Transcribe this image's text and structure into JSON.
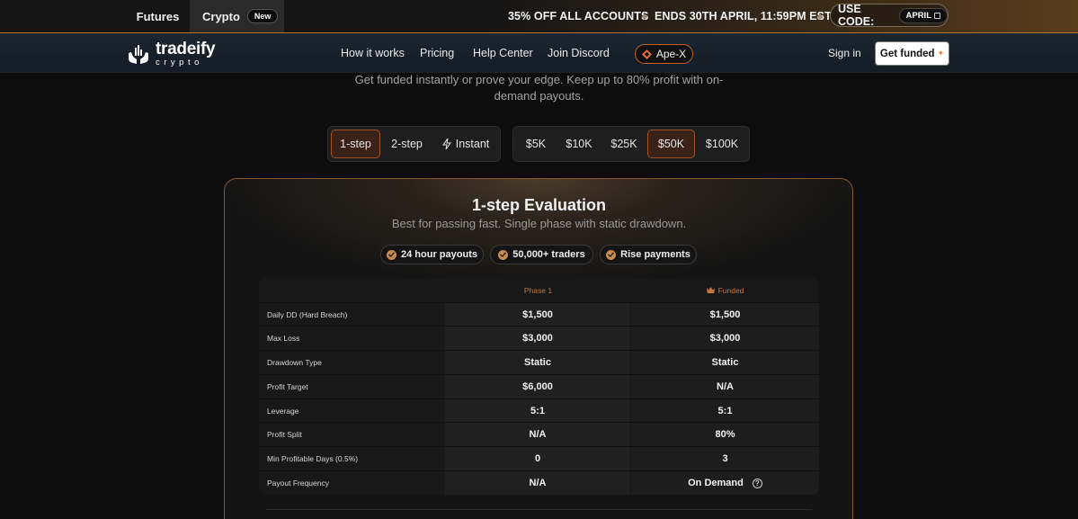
{
  "promo": {
    "tabs": [
      {
        "label": "Futures"
      },
      {
        "label": "Crypto",
        "badge": "New"
      }
    ],
    "messages": [
      "35% OFF ALL ACCOUNTS",
      "ENDS 30TH APRIL, 11:59PM EST"
    ],
    "code_label": "USE CODE:",
    "code_value": "APRIL"
  },
  "nav": {
    "brand_name": "tradeify",
    "brand_sub": "crypto",
    "links": [
      "How it works",
      "Pricing",
      "Help Center",
      "Join Discord"
    ],
    "apex_label": "Ape-X",
    "sign_in": "Sign in",
    "cta": "Get funded"
  },
  "hero": {
    "subtitle": "Get funded instantly or prove your edge. Keep up to 80% profit with on-demand payouts."
  },
  "selectors": {
    "steps": [
      {
        "label": "1-step",
        "active": true
      },
      {
        "label": "2-step",
        "active": false
      },
      {
        "label": "Instant",
        "active": false
      }
    ],
    "sizes": [
      {
        "label": "$5K",
        "active": false
      },
      {
        "label": "$10K",
        "active": false
      },
      {
        "label": "$25K",
        "active": false
      },
      {
        "label": "$50K",
        "active": true
      },
      {
        "label": "$100K",
        "active": false
      }
    ]
  },
  "card": {
    "title": "1-step Evaluation",
    "subtitle": "Best for passing fast. Single phase with static drawdown.",
    "badges": [
      "24 hour payouts",
      "50,000+ traders",
      "Rise payments"
    ]
  },
  "table": {
    "columns": [
      "Phase 1",
      "Funded"
    ],
    "rows": [
      {
        "label": "Daily DD (Hard Breach)",
        "phase1": "$1,500",
        "funded": "$1,500"
      },
      {
        "label": "Max Loss",
        "phase1": "$3,000",
        "funded": "$3,000"
      },
      {
        "label": "Drawdown Type",
        "phase1": "Static",
        "funded": "Static"
      },
      {
        "label": "Profit Target",
        "phase1": "$6,000",
        "funded": "N/A"
      },
      {
        "label": "Leverage",
        "phase1": "5:1",
        "funded": "5:1"
      },
      {
        "label": "Profit Split",
        "phase1": "N/A",
        "funded": "80%"
      },
      {
        "label": "Min Profitable Days (0.5%)",
        "phase1": "0",
        "funded": "3"
      },
      {
        "label": "Payout Frequency",
        "phase1": "N/A",
        "funded": "On Demand"
      }
    ],
    "help_glyph": "?"
  },
  "colors": {
    "accent": "#c8763c",
    "active_bg": "#3a2218",
    "active_border": "#a0532b",
    "card_border": "#8a5a2e"
  },
  "icons": {
    "diamond": "◆",
    "spark": "✦"
  }
}
